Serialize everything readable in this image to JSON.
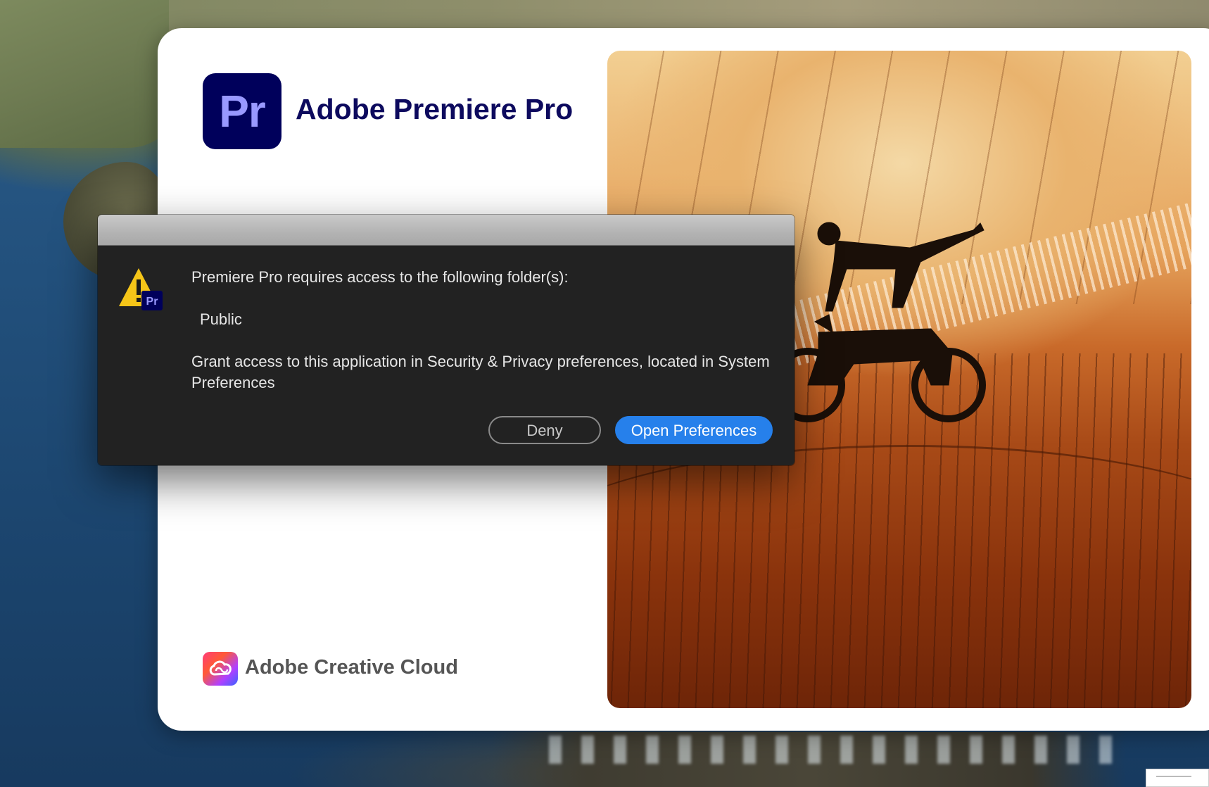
{
  "splash": {
    "app_logo_text": "Pr",
    "app_title": "Adobe Premiere Pro",
    "footer_label": "Adobe Creative Cloud"
  },
  "dialog": {
    "message": "Premiere Pro requires access to the following folder(s):",
    "folder": "Public",
    "instruction_line1": "Grant access to this application in Security & Privacy preferences, located in System",
    "instruction_line2": "Preferences",
    "icon_badge": "Pr",
    "deny_label": "Deny",
    "open_label": "Open Preferences"
  },
  "icons": {
    "warning": "warning-triangle-icon",
    "app": "premiere-pro-logo",
    "creative_cloud": "creative-cloud-logo"
  },
  "colors": {
    "premiere_bg": "#00005b",
    "premiere_fg": "#9999ff",
    "title": "#0d0a5e",
    "dialog_bg": "#222222",
    "primary_button": "#2680eb",
    "warning": "#f5c518"
  }
}
